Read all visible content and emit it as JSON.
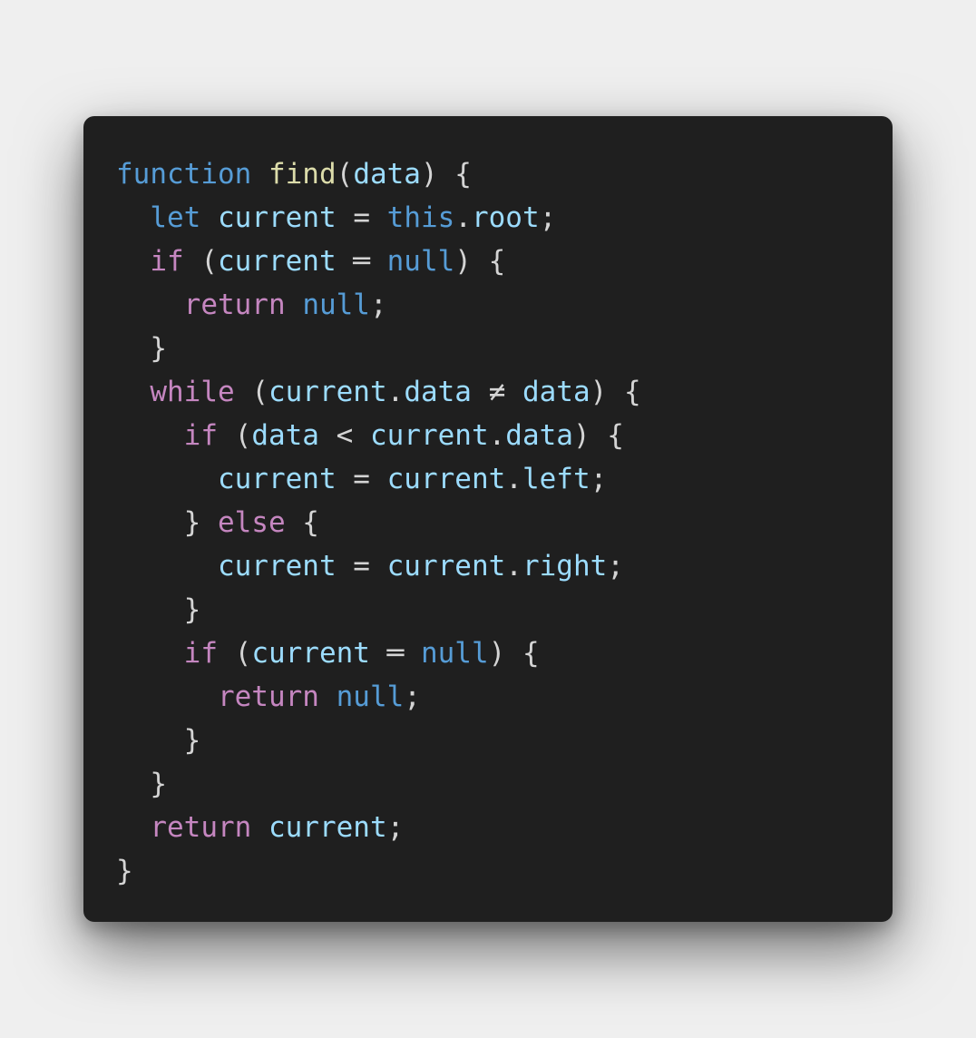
{
  "code": {
    "language": "javascript",
    "lines": [
      [
        {
          "text": "function",
          "type": "keyword"
        },
        {
          "text": " ",
          "type": "punct"
        },
        {
          "text": "find",
          "type": "function"
        },
        {
          "text": "(",
          "type": "punct"
        },
        {
          "text": "data",
          "type": "variable"
        },
        {
          "text": ") {",
          "type": "punct"
        }
      ],
      [
        {
          "text": "  ",
          "type": "punct"
        },
        {
          "text": "let",
          "type": "keyword"
        },
        {
          "text": " ",
          "type": "punct"
        },
        {
          "text": "current",
          "type": "variable"
        },
        {
          "text": " = ",
          "type": "punct"
        },
        {
          "text": "this",
          "type": "keyword"
        },
        {
          "text": ".",
          "type": "punct"
        },
        {
          "text": "root",
          "type": "variable"
        },
        {
          "text": ";",
          "type": "punct"
        }
      ],
      [
        {
          "text": "  ",
          "type": "punct"
        },
        {
          "text": "if",
          "type": "control"
        },
        {
          "text": " (",
          "type": "punct"
        },
        {
          "text": "current",
          "type": "variable"
        },
        {
          "text": " ═ ",
          "type": "punct"
        },
        {
          "text": "null",
          "type": "keyword"
        },
        {
          "text": ") {",
          "type": "punct"
        }
      ],
      [
        {
          "text": "    ",
          "type": "punct"
        },
        {
          "text": "return",
          "type": "control"
        },
        {
          "text": " ",
          "type": "punct"
        },
        {
          "text": "null",
          "type": "keyword"
        },
        {
          "text": ";",
          "type": "punct"
        }
      ],
      [
        {
          "text": "  }",
          "type": "punct"
        }
      ],
      [
        {
          "text": "  ",
          "type": "punct"
        },
        {
          "text": "while",
          "type": "control"
        },
        {
          "text": " (",
          "type": "punct"
        },
        {
          "text": "current",
          "type": "variable"
        },
        {
          "text": ".",
          "type": "punct"
        },
        {
          "text": "data",
          "type": "variable"
        },
        {
          "text": " ≠ ",
          "type": "punct"
        },
        {
          "text": "data",
          "type": "variable"
        },
        {
          "text": ") {",
          "type": "punct"
        }
      ],
      [
        {
          "text": "    ",
          "type": "punct"
        },
        {
          "text": "if",
          "type": "control"
        },
        {
          "text": " (",
          "type": "punct"
        },
        {
          "text": "data",
          "type": "variable"
        },
        {
          "text": " < ",
          "type": "punct"
        },
        {
          "text": "current",
          "type": "variable"
        },
        {
          "text": ".",
          "type": "punct"
        },
        {
          "text": "data",
          "type": "variable"
        },
        {
          "text": ") {",
          "type": "punct"
        }
      ],
      [
        {
          "text": "      ",
          "type": "punct"
        },
        {
          "text": "current",
          "type": "variable"
        },
        {
          "text": " = ",
          "type": "punct"
        },
        {
          "text": "current",
          "type": "variable"
        },
        {
          "text": ".",
          "type": "punct"
        },
        {
          "text": "left",
          "type": "variable"
        },
        {
          "text": ";",
          "type": "punct"
        }
      ],
      [
        {
          "text": "    } ",
          "type": "punct"
        },
        {
          "text": "else",
          "type": "control"
        },
        {
          "text": " {",
          "type": "punct"
        }
      ],
      [
        {
          "text": "      ",
          "type": "punct"
        },
        {
          "text": "current",
          "type": "variable"
        },
        {
          "text": " = ",
          "type": "punct"
        },
        {
          "text": "current",
          "type": "variable"
        },
        {
          "text": ".",
          "type": "punct"
        },
        {
          "text": "right",
          "type": "variable"
        },
        {
          "text": ";",
          "type": "punct"
        }
      ],
      [
        {
          "text": "    }",
          "type": "punct"
        }
      ],
      [
        {
          "text": "    ",
          "type": "punct"
        },
        {
          "text": "if",
          "type": "control"
        },
        {
          "text": " (",
          "type": "punct"
        },
        {
          "text": "current",
          "type": "variable"
        },
        {
          "text": " ═ ",
          "type": "punct"
        },
        {
          "text": "null",
          "type": "keyword"
        },
        {
          "text": ") {",
          "type": "punct"
        }
      ],
      [
        {
          "text": "      ",
          "type": "punct"
        },
        {
          "text": "return",
          "type": "control"
        },
        {
          "text": " ",
          "type": "punct"
        },
        {
          "text": "null",
          "type": "keyword"
        },
        {
          "text": ";",
          "type": "punct"
        }
      ],
      [
        {
          "text": "    }",
          "type": "punct"
        }
      ],
      [
        {
          "text": "  }",
          "type": "punct"
        }
      ],
      [
        {
          "text": "  ",
          "type": "punct"
        },
        {
          "text": "return",
          "type": "control"
        },
        {
          "text": " ",
          "type": "punct"
        },
        {
          "text": "current",
          "type": "variable"
        },
        {
          "text": ";",
          "type": "punct"
        }
      ],
      [
        {
          "text": "}",
          "type": "punct"
        }
      ]
    ]
  },
  "colors": {
    "background": "#efefef",
    "editor_background": "#1f1f1f",
    "keyword": "#569cd6",
    "control": "#c586c0",
    "function": "#dcdcaa",
    "variable": "#9cdcfe",
    "punctuation": "#d4d4d4"
  }
}
